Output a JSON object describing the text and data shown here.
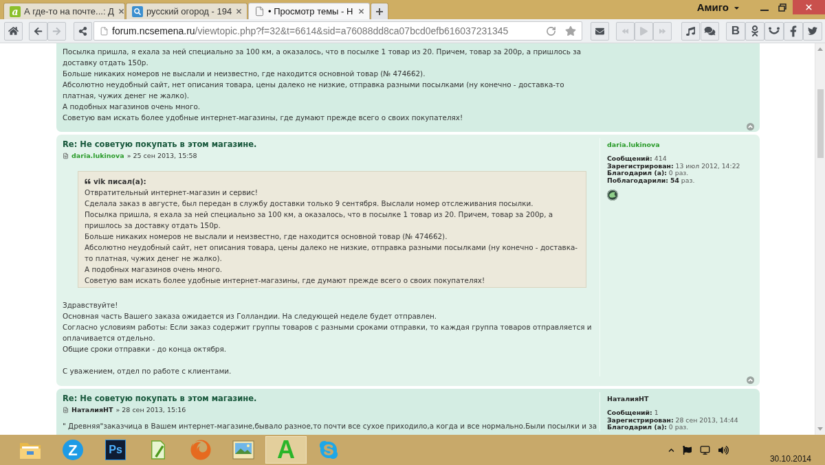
{
  "browser": {
    "name": "Амиго"
  },
  "tabs": [
    {
      "title": "А где-то на почте...: Д",
      "selected": false,
      "icon": {
        "kind": "letter",
        "label": "a"
      }
    },
    {
      "title": "русский огород - 194",
      "selected": false,
      "icon": {
        "kind": "search"
      }
    },
    {
      "title": "• Просмотр темы - Н",
      "selected": true,
      "icon": {
        "kind": "page"
      }
    }
  ],
  "navigation": [
    {
      "kind": "back",
      "disabled": false
    },
    {
      "kind": "forward",
      "disabled": true
    }
  ],
  "address_bar": {
    "host": "forum.ncsemena.ru",
    "path": "/viewtopic.php?f=32&t=6614&sid=a76088dd8ca07bcd0efb616037231345"
  },
  "media_buttons": [
    {
      "kind": "rewind",
      "disabled": true
    },
    {
      "kind": "play",
      "disabled": true
    },
    {
      "kind": "forward",
      "disabled": true
    }
  ],
  "social_buttons": [
    {
      "kind": "letter",
      "label": "В"
    },
    {
      "kind": "figure"
    },
    {
      "kind": "smile"
    },
    {
      "kind": "facebook"
    },
    {
      "kind": "bird"
    }
  ],
  "posts": [
    {
      "back_to_top": true,
      "body": [
        [
          "Посылка пришла, я ехала за ней специально за 100 км, а оказалось, что в посылке 1 товар из 20. Причем, товар за 200р, а пришлось за доставку отдать 150р.",
          "Больше никаких номеров не выслали и неизвестно, где находится основной товар (№ 474662).",
          "Абсолютно неудобный сайт, нет описания товара, цены далеко не низкие, отправка разными посылками (ну конечно - доставка-то платная, чужих денег не жалко).",
          "А подобных магазинов очень много.",
          "Советую вам искать более удобные интернет-магазины, где думают прежде всего о своих покупателях!"
        ]
      ]
    },
    {
      "back_to_top": true,
      "title": "Re: Не советую покупать в этом магазине.",
      "author": {
        "name": "daria.lukinova",
        "color": "#2a9b2a"
      },
      "date": "» 25 сен 2013, 15:58",
      "quote": {
        "cite": "vik писал(а):",
        "lines": [
          "Отвратительный интернет-магазин и сервис!",
          "Сделала заказ в августе, был передан в службу доставки только 9 сентября. Выслали номер отслеживания посылки.",
          "Посылка пришла, я ехала за ней специально за 100 км, а оказалось, что в посылке 1 товар из 20. Причем, товар за 200р, а пришлось за доставку отдать 150р.",
          "Больше никаких номеров не выслали и неизвестно, где находится основной товар (№ 474662).",
          "Абсолютно неудобный сайт, нет описания товара, цены далеко не низкие, отправка разными посылками (ну конечно - доставка-то платная, чужих денег не жалко).",
          "А подобных магазинов очень много.",
          "Советую вам искать более удобные интернет-магазины, где думают прежде всего о своих покупателях!"
        ]
      },
      "body": [
        [
          "Здравствуйте!",
          "Основная часть Вашего заказа ожидается из Голландии. На следующей неделе будет отправлен.",
          "Согласно условиям работы: Если заказ содержит группы товаров с разными сроками отправки, то каждая группа товаров отправляется и оплачивается отдельно.",
          "Общие сроки отправки - до конца октября."
        ],
        [
          "С уважением, отдел по работе с клиентами."
        ]
      ],
      "profile": {
        "name": "daria.lukinova",
        "color": "#2a9b2a",
        "rows": [
          "**Сообщений:** 414",
          "**Зарегистрирован:** 13 июл 2012, 14:22",
          "**Благодарил (а):** 0 раз.",
          "**Поблагодарили:** **54** раз."
        ],
        "contacts": [
          {
            "kind": "website"
          }
        ]
      }
    },
    {
      "title": "Re: Не советую покупать в этом магазине.",
      "author": {
        "name": "НаталияНТ",
        "color": "#222222"
      },
      "date": "» 28 сен 2013, 15:16",
      "body": [
        [
          "\" Древняя\"заказчица в Вашем интернет-магазине,бывало разное,то почти все сухое приходило,а когда и все нормально.Были посылки и за"
        ]
      ],
      "profile": {
        "name": "НаталияНТ",
        "color": "#222222",
        "rows": [
          "**Сообщений:** 1",
          "**Зарегистрирован:** 28 сен 2013, 14:44",
          "**Благодарил (а):** 0 раз."
        ]
      }
    }
  ],
  "taskbar": {
    "apps": [
      {
        "kind": "folder",
        "selected": false
      },
      {
        "kind": "circle-letter",
        "label": "Z",
        "selected": false
      },
      {
        "kind": "square-letter",
        "label": "Ps",
        "selected": false
      },
      {
        "kind": "pen",
        "selected": false
      },
      {
        "kind": "firefox",
        "selected": false
      },
      {
        "kind": "photos",
        "selected": false
      },
      {
        "kind": "big-letter",
        "label": "A",
        "selected": true
      },
      {
        "kind": "skype",
        "selected": false
      }
    ],
    "date": "30.10.2014"
  }
}
